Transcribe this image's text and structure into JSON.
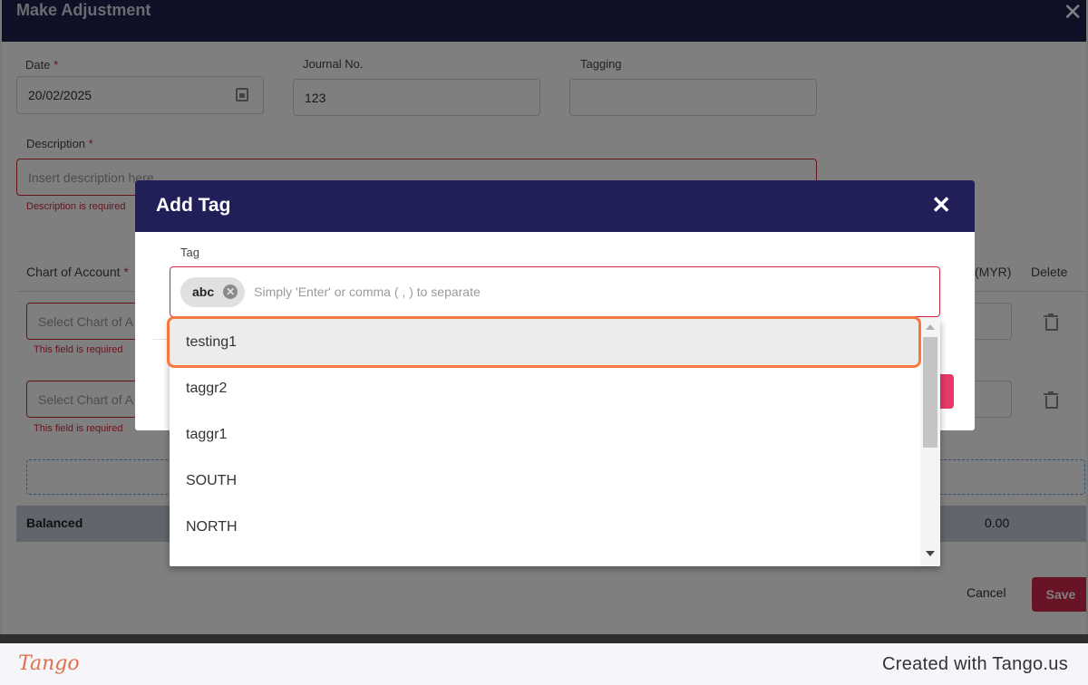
{
  "background_modal": {
    "title": "Make Adjustment",
    "close_icon": "close-icon",
    "date": {
      "label": "Date",
      "required_mark": "*",
      "value": "20/02/2025",
      "icon": "calendar-icon"
    },
    "journal": {
      "label": "Journal No.",
      "value": "123"
    },
    "tagging": {
      "label": "Tagging",
      "value": ""
    },
    "description": {
      "label": "Description",
      "required_mark": "*",
      "placeholder": "Insert description here",
      "error": "Description is required"
    },
    "table": {
      "col_chart_of_account": "Chart of Account",
      "required_mark": "*",
      "col_amount": "(MYR)",
      "col_delete": "Delete",
      "rows": [
        {
          "placeholder": "Select Chart of A",
          "error": "This field is required"
        },
        {
          "placeholder": "Select Chart of A",
          "error": "This field is required"
        }
      ],
      "balanced_label": "Balanced",
      "balanced_value": "0.00"
    },
    "cancel_label": "Cancel",
    "save_label": "Save"
  },
  "add_tag_dialog": {
    "title": "Add Tag",
    "close_icon": "close-icon",
    "tag_label": "Tag",
    "chips": [
      {
        "label": "abc",
        "remove_icon": "remove-chip-icon"
      }
    ],
    "input_placeholder": "Simply 'Enter' or comma ( , ) to separate",
    "options": [
      "testing1",
      "taggr2",
      "taggr1",
      "SOUTH",
      "NORTH"
    ],
    "highlighted_option": "testing1"
  },
  "footer": {
    "logo": "Tango",
    "credit": "Created with Tango.us"
  },
  "colors": {
    "header_bg": "#1e1f4d",
    "dialog_header_bg": "#211f57",
    "error": "#d0293b",
    "save_button": "#d2294a",
    "highlight_outline": "#f57a41"
  }
}
